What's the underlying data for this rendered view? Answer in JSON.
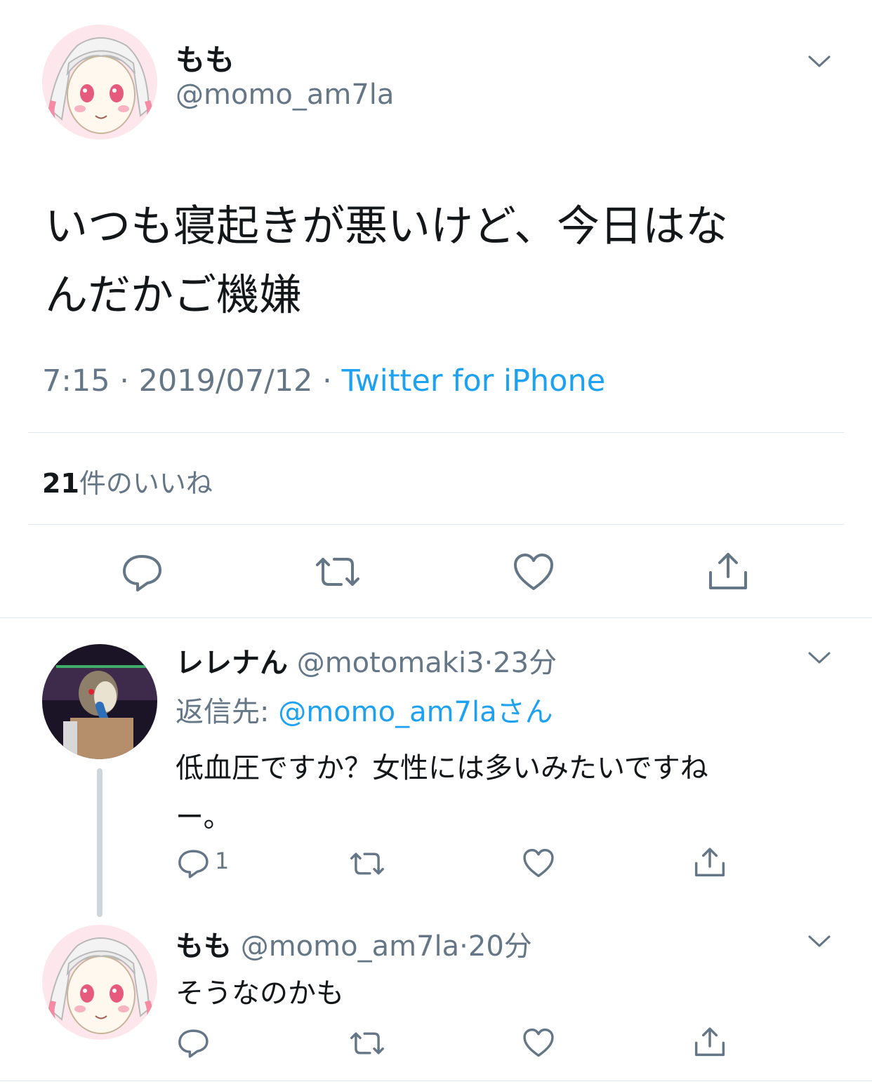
{
  "main_tweet": {
    "display_name": "もも",
    "handle": "@momo_am7la",
    "text_line1": "いつも寝起きが悪いけど、今日はな",
    "text_line2": "んだかご機嫌",
    "time": "7:15",
    "sep1": "·",
    "date": "2019/07/12",
    "sep2": "·",
    "source": "Twitter for iPhone",
    "likes_count": "21",
    "likes_label": "件のいいね"
  },
  "reply1": {
    "display_name": "レレナん",
    "handle": "@motomaki3",
    "sep": "·",
    "time_ago": "23分",
    "reply_to_label": "返信先:",
    "reply_to_handle": "@momo_am7laさん",
    "text_line1": "低血圧ですか？女性には多いみたいですね",
    "text_line2": "ー。",
    "reply_count": "1"
  },
  "reply2": {
    "display_name": "もも",
    "handle": "@momo_am7la",
    "sep": "·",
    "time_ago": "20分",
    "text": "そうなのかも"
  },
  "colors": {
    "link": "#1da1f2",
    "secondary": "#657786",
    "icon": "#657786",
    "divider": "#e1e8ed",
    "thread_line": "#ccd6dd"
  },
  "icons": [
    "chevron-down-icon",
    "reply-icon",
    "retweet-icon",
    "like-icon",
    "share-icon"
  ]
}
